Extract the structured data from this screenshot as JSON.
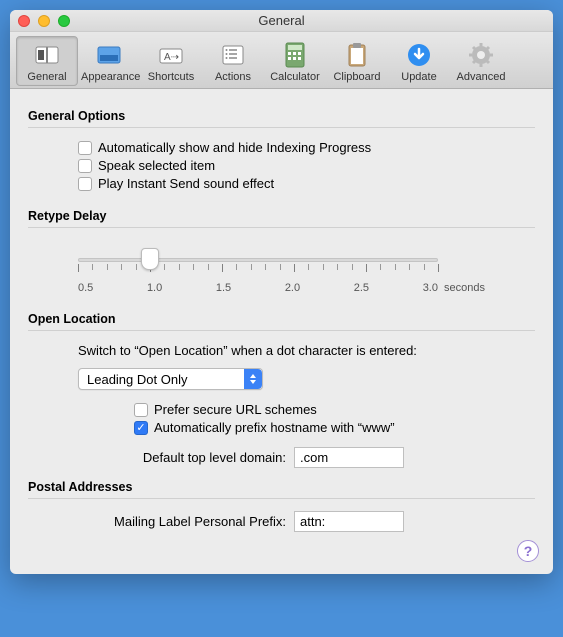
{
  "window": {
    "title": "General"
  },
  "toolbar": {
    "items": [
      {
        "label": "General"
      },
      {
        "label": "Appearance"
      },
      {
        "label": "Shortcuts"
      },
      {
        "label": "Actions"
      },
      {
        "label": "Calculator"
      },
      {
        "label": "Clipboard"
      },
      {
        "label": "Update"
      },
      {
        "label": "Advanced"
      }
    ]
  },
  "sections": {
    "general_options": {
      "title": "General Options",
      "items": [
        "Automatically show and hide Indexing Progress",
        "Speak selected item",
        "Play Instant Send sound effect"
      ]
    },
    "retype_delay": {
      "title": "Retype Delay",
      "labels": [
        "0.5",
        "1.0",
        "1.5",
        "2.0",
        "2.5",
        "3.0"
      ],
      "unit": "seconds",
      "value": 1.0,
      "min": 0.5,
      "max": 3.0
    },
    "open_location": {
      "title": "Open Location",
      "prompt": "Switch to “Open Location” when a dot character is entered:",
      "select_value": "Leading Dot Only",
      "prefer_secure": "Prefer secure URL schemes",
      "auto_www": "Automatically prefix hostname with “www”",
      "tld_label": "Default top level domain:",
      "tld_value": ".com"
    },
    "postal": {
      "title": "Postal Addresses",
      "prefix_label": "Mailing Label Personal Prefix:",
      "prefix_value": "attn:"
    }
  }
}
